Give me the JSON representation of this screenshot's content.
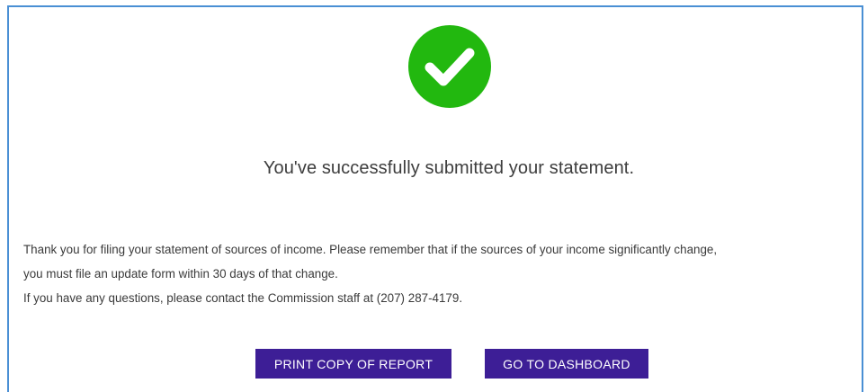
{
  "confirmation": {
    "icon": "check-circle-icon",
    "icon_color": "#22b80f",
    "headline": "You've successfully submitted your statement.",
    "body_lines": [
      "Thank you for filing your statement of sources of income. Please remember that if the sources of your income significantly change,",
      "you must file an update form within 30 days of that change.",
      "If you have any questions, please contact the Commission staff at (207) 287-4179."
    ]
  },
  "actions": {
    "print_label": "PRINT COPY OF REPORT",
    "dashboard_label": "GO TO DASHBOARD",
    "button_color": "#3d1e96"
  },
  "frame": {
    "border_color": "#4a8fd4"
  }
}
